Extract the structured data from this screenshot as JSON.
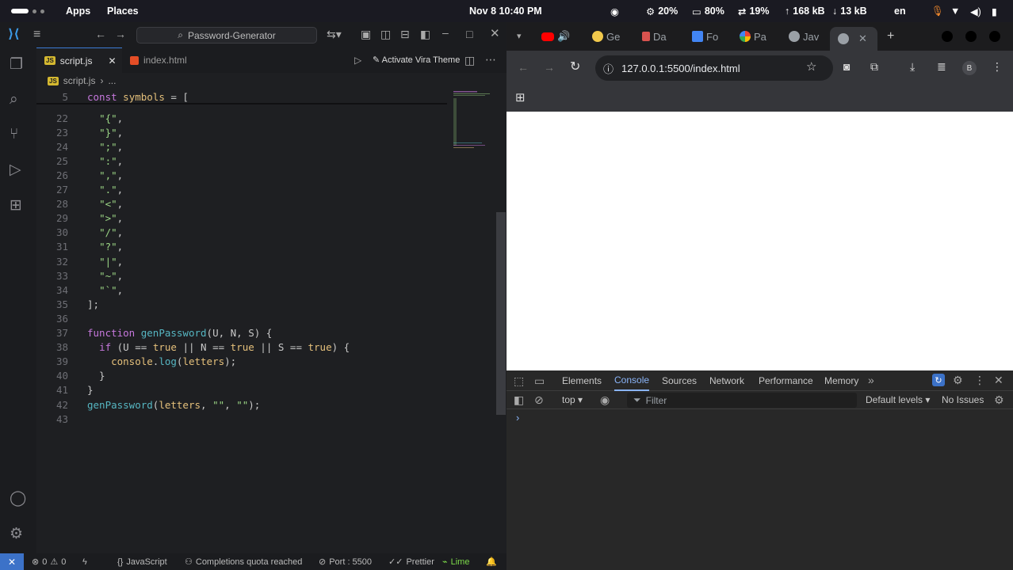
{
  "system_bar": {
    "apps": "Apps",
    "places": "Places",
    "datetime": "Nov 8  10:40 PM",
    "cpu": "20%",
    "ram": "80%",
    "network": "19%",
    "upload": "168 kB",
    "download": "13 kB",
    "lang": "en"
  },
  "vscode": {
    "search_placeholder": "Password-Generator",
    "tabs": [
      {
        "label": "script.js",
        "badge": "JS"
      },
      {
        "label": "index.html"
      }
    ],
    "run_theme_label": "Activate Vira Theme",
    "breadcrumb": {
      "file": "script.js",
      "rest": "..."
    },
    "sticky_line": {
      "num": "5",
      "text": "const symbols = ["
    },
    "lines": [
      {
        "num": "22",
        "text": "  \"{\","
      },
      {
        "num": "23",
        "text": "  \"}\","
      },
      {
        "num": "24",
        "text": "  \";\","
      },
      {
        "num": "25",
        "text": "  \":\","
      },
      {
        "num": "26",
        "text": "  \",\","
      },
      {
        "num": "27",
        "text": "  \".\","
      },
      {
        "num": "28",
        "text": "  \"<\","
      },
      {
        "num": "29",
        "text": "  \">\","
      },
      {
        "num": "30",
        "text": "  \"/\","
      },
      {
        "num": "31",
        "text": "  \"?\","
      },
      {
        "num": "32",
        "text": "  \"|\","
      },
      {
        "num": "33",
        "text": "  \"~\","
      },
      {
        "num": "34",
        "text": "  \"`\","
      },
      {
        "num": "35",
        "text": "];"
      },
      {
        "num": "36",
        "text": ""
      },
      {
        "num": "37",
        "text": "function genPassword(U, N, S) {"
      },
      {
        "num": "38",
        "text": "  if (U == true || N == true || S == true) {"
      },
      {
        "num": "39",
        "text": "    console.log(letters);"
      },
      {
        "num": "40",
        "text": "  }"
      },
      {
        "num": "41",
        "text": "}"
      },
      {
        "num": "42",
        "text": "genPassword(letters, \"\", \"\");"
      },
      {
        "num": "43",
        "text": ""
      }
    ],
    "status": {
      "errors": "0",
      "warnings": "0",
      "language": "JavaScript",
      "completions": "Completions quota reached",
      "port": "Port : 5500",
      "prettier": "Prettier",
      "lime": "Lime"
    }
  },
  "chrome": {
    "tabs": [
      {
        "label": "Ge"
      },
      {
        "label": "Da"
      },
      {
        "label": "Fo"
      },
      {
        "label": "Pa"
      },
      {
        "label": "Jav"
      }
    ],
    "url": "127.0.0.1:5500/index.html",
    "profile_initial": "B",
    "devtools": {
      "tabs": [
        "Elements",
        "Console",
        "Sources",
        "Network",
        "Performance",
        "Memory"
      ],
      "active_tab": "Console",
      "context": "top",
      "filter_placeholder": "Filter",
      "levels": "Default levels",
      "issues": "No Issues",
      "prompt": "›"
    }
  },
  "colors": {
    "accent": "#3c7bd5",
    "statusbar_remote": "#3c72c8",
    "devtools_active": "#8ab4f8"
  }
}
